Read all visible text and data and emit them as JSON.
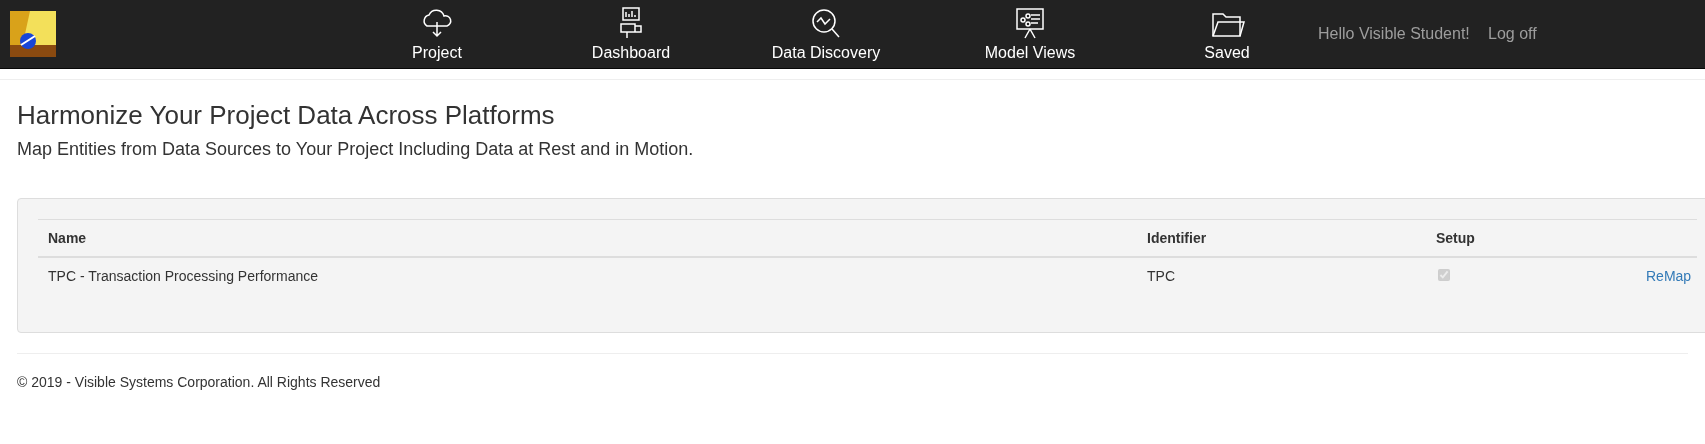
{
  "navbar": {
    "nav_items": [
      {
        "kind": "cloud",
        "label": "Project"
      },
      {
        "kind": "dashboard",
        "label": "Dashboard"
      },
      {
        "kind": "discovery",
        "label": "Data Discovery"
      },
      {
        "kind": "board",
        "label": "Model Views"
      },
      {
        "kind": "folder",
        "label": "Saved"
      }
    ],
    "greeting": "Hello Visible Student!",
    "logoff": "Log off"
  },
  "heading": "Harmonize Your Project Data Across Platforms",
  "subheading": "Map Entities from Data Sources to Your Project Including Data at Rest and in Motion.",
  "table": {
    "columns": [
      "Name",
      "Identifier",
      "Setup"
    ],
    "rows": [
      {
        "name": "TPC - Transaction Processing Performance",
        "identifier": "TPC",
        "setup_checked": true,
        "action": "ReMap"
      }
    ]
  },
  "footer": "© 2019 - Visible Systems Corporation. All Rights Reserved"
}
